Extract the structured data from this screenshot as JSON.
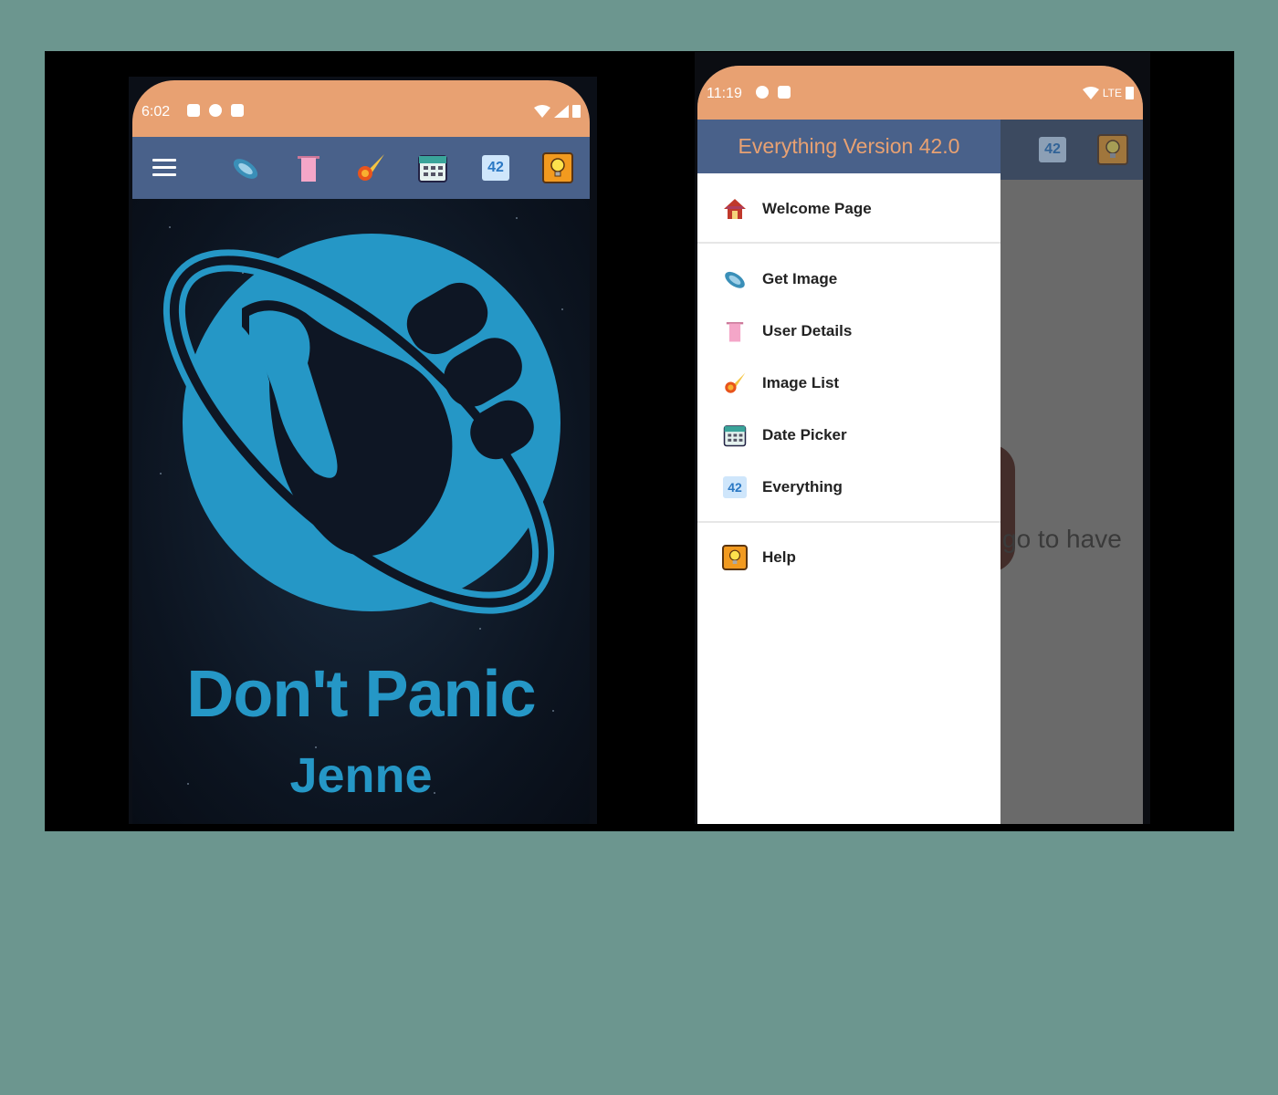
{
  "left_phone": {
    "status": {
      "time": "6:02"
    },
    "toolbar_icons": [
      "ufo-icon",
      "towel-icon",
      "meteor-icon",
      "calendar-icon",
      "number-42-icon",
      "lightbulb-icon"
    ],
    "badge_42": "42",
    "headline": "Don't Panic",
    "user_name": "Jenne"
  },
  "right_phone": {
    "status": {
      "time": "11:19",
      "network": "LTE"
    },
    "drawer": {
      "title": "Everything Version 42.0",
      "items": [
        {
          "label": "Welcome Page",
          "icon": "house-icon"
        },
        {
          "label": "Get Image",
          "icon": "ufo-icon"
        },
        {
          "label": "User Details",
          "icon": "towel-icon"
        },
        {
          "label": "Image List",
          "icon": "meteor-icon"
        },
        {
          "label": "Date Picker",
          "icon": "calendar-icon"
        },
        {
          "label": "Everything",
          "icon": "number-42-icon"
        },
        {
          "label": "Help",
          "icon": "lightbulb-icon"
        }
      ],
      "badge_42": "42"
    },
    "background_text": "go to have",
    "appbar_badge_42": "42"
  },
  "colors": {
    "page_bg": "#6c968f",
    "status_bar": "#e8a172",
    "app_bar": "#49618a",
    "logo_blue": "#2597c6"
  }
}
